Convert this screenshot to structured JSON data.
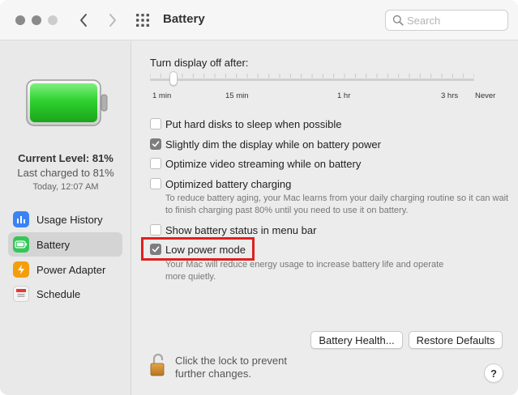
{
  "window": {
    "title": "Battery",
    "search_placeholder": "Search"
  },
  "sidebar": {
    "current_level": "Current Level: 81%",
    "last_charged": "Last charged to 81%",
    "charged_time": "Today, 12:07 AM",
    "battery_fill_fraction": 0.81,
    "items": [
      {
        "label": "Usage History",
        "icon": "usage-history-icon",
        "color": "#3b82f6",
        "selected": false
      },
      {
        "label": "Battery",
        "icon": "battery-icon",
        "color": "#34c759",
        "selected": true
      },
      {
        "label": "Power Adapter",
        "icon": "power-adapter-icon",
        "color": "#f59e0b",
        "selected": false
      },
      {
        "label": "Schedule",
        "icon": "schedule-icon",
        "color": "#f2f2f2",
        "selected": false
      }
    ]
  },
  "main": {
    "display_off": {
      "title": "Turn display off after:",
      "tick_labels": [
        "1 min",
        "15 min",
        "1 hr",
        "3 hrs",
        "Never"
      ],
      "selected": "1 min"
    },
    "options": [
      {
        "label": "Put hard disks to sleep when possible",
        "checked": false
      },
      {
        "label": "Slightly dim the display while on battery power",
        "checked": true
      },
      {
        "label": "Optimize video streaming while on battery",
        "checked": false
      },
      {
        "label": "Optimized battery charging",
        "checked": false,
        "description": "To reduce battery aging, your Mac learns from your daily charging routine so it can wait to finish charging past 80% until you need to use it on battery."
      },
      {
        "label": "Show battery status in menu bar",
        "checked": false
      },
      {
        "label": "Low power mode",
        "checked": true,
        "description": "Your Mac will reduce energy usage to increase battery life and operate more quietly."
      }
    ],
    "buttons": {
      "battery_health": "Battery Health...",
      "restore_defaults": "Restore Defaults"
    },
    "lock_text": "Click the lock to prevent further changes.",
    "help_label": "?"
  },
  "colors": {
    "highlight": "#e02020",
    "battery_green": "#2fd12f"
  }
}
